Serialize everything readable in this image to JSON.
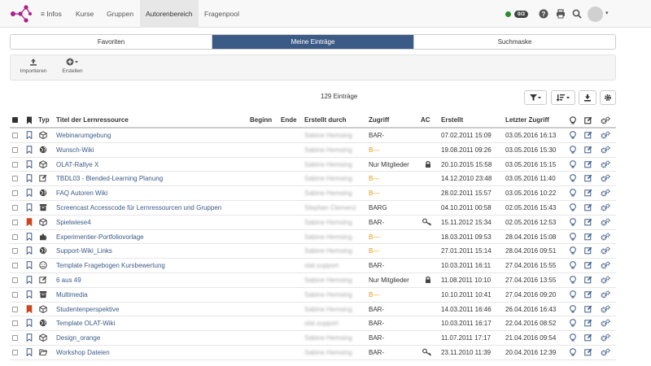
{
  "nav": {
    "items": [
      "≡ Infos",
      "Kurse",
      "Gruppen",
      "Autorenbereich",
      "Fragenpool"
    ],
    "active": "Autorenbereich",
    "counter": "0/3"
  },
  "tabs": [
    "Favoriten",
    "Meine Einträge",
    "Suchmaske"
  ],
  "toolbar": {
    "import_label": "Importieren",
    "create_label": "Erstellen"
  },
  "entry_count": "129 Einträge",
  "columns": {
    "type": "Typ",
    "title": "Titel der Lernressource",
    "begin": "Beginn",
    "end": "Ende",
    "created_by": "Erstellt durch",
    "access": "Zugriff",
    "ac": "AC",
    "created": "Erstellt",
    "last_access": "Letzter Zugriff"
  },
  "rows": [
    {
      "bookmarked": false,
      "type_icon": "course-icon",
      "title": "Webinarumgebung",
      "created_by": "Sabine Hemsing",
      "access": "BAR-",
      "access_style": "normal",
      "ac_key": false,
      "ac_lock": false,
      "created": "07.02.2011 15:09",
      "last_access": "03.05.2016 16:13"
    },
    {
      "bookmarked": false,
      "type_icon": "globe-icon",
      "title": "Wunsch-Wiki",
      "created_by": "Sabine Hemsing",
      "access": "B---",
      "access_style": "orange",
      "ac_key": false,
      "ac_lock": false,
      "created": "19.08.2011 09:26",
      "last_access": "03.05.2016 15:30"
    },
    {
      "bookmarked": false,
      "type_icon": "course-icon",
      "title": "OLAT-Rallye X",
      "created_by": "Sabine Hemsing",
      "access": "Nur Mitglieder",
      "access_style": "normal",
      "ac_key": false,
      "ac_lock": true,
      "created": "20.10.2015 15:58",
      "last_access": "03.05.2016 15:15"
    },
    {
      "bookmarked": false,
      "type_icon": "edit-icon",
      "title": "TBDL03 - Blended-Learning Planung",
      "created_by": "Sabine Hemsing",
      "access": "B---",
      "access_style": "orange",
      "ac_key": false,
      "ac_lock": false,
      "created": "14.12.2010 23:48",
      "last_access": "03.05.2016 11:40"
    },
    {
      "bookmarked": false,
      "type_icon": "globe-icon",
      "title": "FAQ Autoren Wiki",
      "created_by": "Sabine Hemsing",
      "access": "B---",
      "access_style": "orange",
      "ac_key": false,
      "ac_lock": false,
      "created": "28.02.2011 15:57",
      "last_access": "03.05.2016 10:22"
    },
    {
      "bookmarked": false,
      "type_icon": "archive-icon",
      "title": "Screencast Accesscode für Lernressourcen und Gruppen",
      "created_by": "Stephan Clemenz",
      "access": "BARG",
      "access_style": "normal",
      "ac_key": false,
      "ac_lock": false,
      "created": "04.10.2011 00:58",
      "last_access": "02.05.2016 15:43"
    },
    {
      "bookmarked": true,
      "type_icon": "course-icon",
      "title": "Spielwiese4",
      "created_by": "Sabine Hemsing",
      "access": "BAR-",
      "access_style": "normal",
      "ac_key": true,
      "ac_lock": false,
      "created": "15.11.2012 15:34",
      "last_access": "02.05.2016 12:53"
    },
    {
      "bookmarked": false,
      "type_icon": "puzzle-icon",
      "title": "Experimentier-Portfoliovorlage",
      "created_by": "Sabine Hemsing",
      "access": "B---",
      "access_style": "orange",
      "ac_key": false,
      "ac_lock": false,
      "created": "18.03.2011 09:53",
      "last_access": "28.04.2016 15:08"
    },
    {
      "bookmarked": false,
      "type_icon": "globe-icon",
      "title": "Support-Wiki_Links",
      "created_by": "Sabine Hemsing",
      "access": "B---",
      "access_style": "orange",
      "ac_key": false,
      "ac_lock": false,
      "created": "27.01.2011 15:14",
      "last_access": "28.04.2016 09:51"
    },
    {
      "bookmarked": false,
      "type_icon": "smiley-icon",
      "title": "Template Fragebogen Kursbewertung",
      "created_by": "olat.support",
      "access": "BAR-",
      "access_style": "normal",
      "ac_key": false,
      "ac_lock": false,
      "created": "10.03.2011 16:11",
      "last_access": "27.04.2016 15:55"
    },
    {
      "bookmarked": false,
      "type_icon": "edit-icon",
      "title": "6 aus 49",
      "created_by": "Sabine Hemsing",
      "access": "Nur Mitglieder",
      "access_style": "normal",
      "ac_key": false,
      "ac_lock": true,
      "created": "11.08.2011 10:10",
      "last_access": "27.04.2016 13:55"
    },
    {
      "bookmarked": false,
      "type_icon": "archive-icon",
      "title": "Multimedia",
      "created_by": "Sabine Hemsing",
      "access": "B---",
      "access_style": "orange",
      "ac_key": false,
      "ac_lock": false,
      "created": "10.10.2011 10:41",
      "last_access": "27.04.2016 09:20"
    },
    {
      "bookmarked": true,
      "type_icon": "course-icon",
      "title": "Studentenperspektive",
      "created_by": "Sabine Hemsing",
      "access": "BAR-",
      "access_style": "normal",
      "ac_key": false,
      "ac_lock": false,
      "created": "14.03.2011 16:46",
      "last_access": "26.04.2016 16:43"
    },
    {
      "bookmarked": false,
      "type_icon": "globe-icon",
      "title": "Template OLAT-Wiki",
      "created_by": "olat.support",
      "access": "BAR-",
      "access_style": "normal",
      "ac_key": false,
      "ac_lock": false,
      "created": "10.03.2011 16:17",
      "last_access": "22.04.2016 08:52"
    },
    {
      "bookmarked": false,
      "type_icon": "course-icon",
      "title": "Design_orange",
      "created_by": "Sabine Hemsing",
      "access": "BAR-",
      "access_style": "normal",
      "ac_key": false,
      "ac_lock": false,
      "created": "11.07.2011 17:17",
      "last_access": "21.04.2016 09:54"
    },
    {
      "bookmarked": false,
      "type_icon": "folder-icon",
      "title": "Workshop Dateien",
      "created_by": "Sabine Hemsing",
      "access": "BAR-",
      "access_style": "normal",
      "ac_key": true,
      "ac_lock": false,
      "created": "23.11.2010 11:39",
      "last_access": "20.04.2016 12:39"
    }
  ],
  "colors": {
    "accent": "#3c5a86",
    "link": "#3c5a86",
    "bookmark_active": "#d0451b",
    "status_online": "#2e8b2e",
    "access_orange": "#e39a0d",
    "logo": "#b01c8e"
  }
}
